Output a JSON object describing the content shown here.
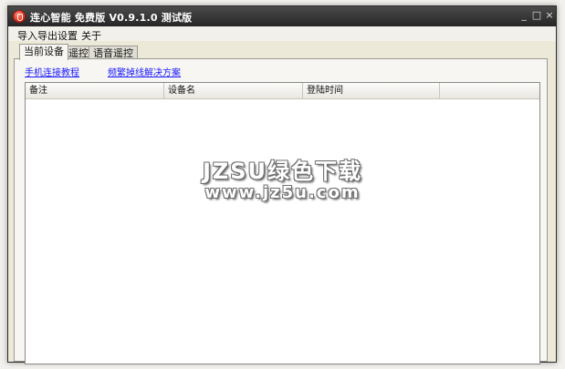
{
  "window": {
    "title": "连心智能 免费版 V0.9.1.0 测试版",
    "min_label": "_",
    "max_label": "□",
    "close_label": "×"
  },
  "menu": {
    "items": [
      "导入导出",
      "设置",
      "关于"
    ]
  },
  "tabs": [
    "当前设备",
    "遥控",
    "语音遥控"
  ],
  "links": {
    "tutorial": "手机连接教程",
    "disconnect": "频繁掉线解决方案"
  },
  "table": {
    "columns": [
      "备注",
      "设备名",
      "登陆时间"
    ],
    "rows": []
  },
  "watermark": {
    "line1": "JZSU绿色下载",
    "line2": "www.jz5u.com"
  }
}
